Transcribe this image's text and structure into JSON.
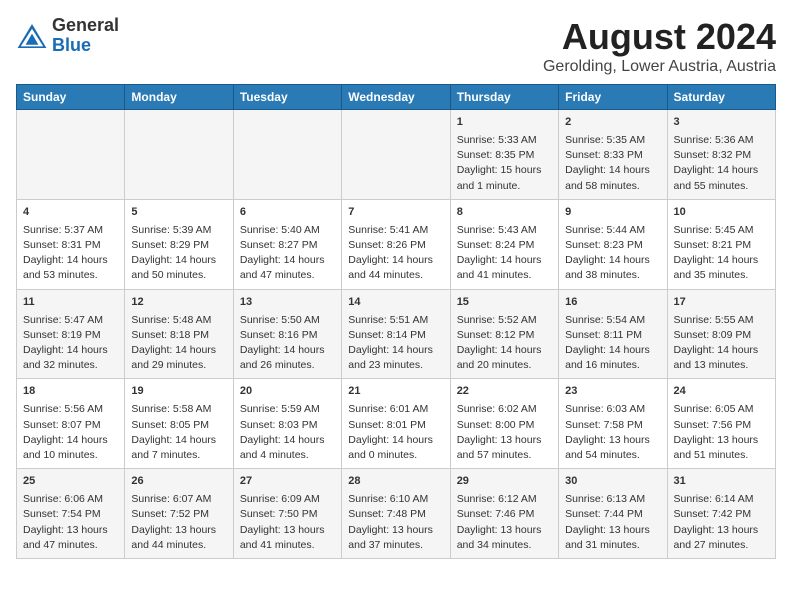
{
  "header": {
    "logo_general": "General",
    "logo_blue": "Blue",
    "main_title": "August 2024",
    "subtitle": "Gerolding, Lower Austria, Austria"
  },
  "columns": [
    "Sunday",
    "Monday",
    "Tuesday",
    "Wednesday",
    "Thursday",
    "Friday",
    "Saturday"
  ],
  "weeks": [
    {
      "days": [
        {
          "num": "",
          "content": ""
        },
        {
          "num": "",
          "content": ""
        },
        {
          "num": "",
          "content": ""
        },
        {
          "num": "",
          "content": ""
        },
        {
          "num": "1",
          "content": "Sunrise: 5:33 AM\nSunset: 8:35 PM\nDaylight: 15 hours\nand 1 minute."
        },
        {
          "num": "2",
          "content": "Sunrise: 5:35 AM\nSunset: 8:33 PM\nDaylight: 14 hours\nand 58 minutes."
        },
        {
          "num": "3",
          "content": "Sunrise: 5:36 AM\nSunset: 8:32 PM\nDaylight: 14 hours\nand 55 minutes."
        }
      ]
    },
    {
      "days": [
        {
          "num": "4",
          "content": "Sunrise: 5:37 AM\nSunset: 8:31 PM\nDaylight: 14 hours\nand 53 minutes."
        },
        {
          "num": "5",
          "content": "Sunrise: 5:39 AM\nSunset: 8:29 PM\nDaylight: 14 hours\nand 50 minutes."
        },
        {
          "num": "6",
          "content": "Sunrise: 5:40 AM\nSunset: 8:27 PM\nDaylight: 14 hours\nand 47 minutes."
        },
        {
          "num": "7",
          "content": "Sunrise: 5:41 AM\nSunset: 8:26 PM\nDaylight: 14 hours\nand 44 minutes."
        },
        {
          "num": "8",
          "content": "Sunrise: 5:43 AM\nSunset: 8:24 PM\nDaylight: 14 hours\nand 41 minutes."
        },
        {
          "num": "9",
          "content": "Sunrise: 5:44 AM\nSunset: 8:23 PM\nDaylight: 14 hours\nand 38 minutes."
        },
        {
          "num": "10",
          "content": "Sunrise: 5:45 AM\nSunset: 8:21 PM\nDaylight: 14 hours\nand 35 minutes."
        }
      ]
    },
    {
      "days": [
        {
          "num": "11",
          "content": "Sunrise: 5:47 AM\nSunset: 8:19 PM\nDaylight: 14 hours\nand 32 minutes."
        },
        {
          "num": "12",
          "content": "Sunrise: 5:48 AM\nSunset: 8:18 PM\nDaylight: 14 hours\nand 29 minutes."
        },
        {
          "num": "13",
          "content": "Sunrise: 5:50 AM\nSunset: 8:16 PM\nDaylight: 14 hours\nand 26 minutes."
        },
        {
          "num": "14",
          "content": "Sunrise: 5:51 AM\nSunset: 8:14 PM\nDaylight: 14 hours\nand 23 minutes."
        },
        {
          "num": "15",
          "content": "Sunrise: 5:52 AM\nSunset: 8:12 PM\nDaylight: 14 hours\nand 20 minutes."
        },
        {
          "num": "16",
          "content": "Sunrise: 5:54 AM\nSunset: 8:11 PM\nDaylight: 14 hours\nand 16 minutes."
        },
        {
          "num": "17",
          "content": "Sunrise: 5:55 AM\nSunset: 8:09 PM\nDaylight: 14 hours\nand 13 minutes."
        }
      ]
    },
    {
      "days": [
        {
          "num": "18",
          "content": "Sunrise: 5:56 AM\nSunset: 8:07 PM\nDaylight: 14 hours\nand 10 minutes."
        },
        {
          "num": "19",
          "content": "Sunrise: 5:58 AM\nSunset: 8:05 PM\nDaylight: 14 hours\nand 7 minutes."
        },
        {
          "num": "20",
          "content": "Sunrise: 5:59 AM\nSunset: 8:03 PM\nDaylight: 14 hours\nand 4 minutes."
        },
        {
          "num": "21",
          "content": "Sunrise: 6:01 AM\nSunset: 8:01 PM\nDaylight: 14 hours\nand 0 minutes."
        },
        {
          "num": "22",
          "content": "Sunrise: 6:02 AM\nSunset: 8:00 PM\nDaylight: 13 hours\nand 57 minutes."
        },
        {
          "num": "23",
          "content": "Sunrise: 6:03 AM\nSunset: 7:58 PM\nDaylight: 13 hours\nand 54 minutes."
        },
        {
          "num": "24",
          "content": "Sunrise: 6:05 AM\nSunset: 7:56 PM\nDaylight: 13 hours\nand 51 minutes."
        }
      ]
    },
    {
      "days": [
        {
          "num": "25",
          "content": "Sunrise: 6:06 AM\nSunset: 7:54 PM\nDaylight: 13 hours\nand 47 minutes."
        },
        {
          "num": "26",
          "content": "Sunrise: 6:07 AM\nSunset: 7:52 PM\nDaylight: 13 hours\nand 44 minutes."
        },
        {
          "num": "27",
          "content": "Sunrise: 6:09 AM\nSunset: 7:50 PM\nDaylight: 13 hours\nand 41 minutes."
        },
        {
          "num": "28",
          "content": "Sunrise: 6:10 AM\nSunset: 7:48 PM\nDaylight: 13 hours\nand 37 minutes."
        },
        {
          "num": "29",
          "content": "Sunrise: 6:12 AM\nSunset: 7:46 PM\nDaylight: 13 hours\nand 34 minutes."
        },
        {
          "num": "30",
          "content": "Sunrise: 6:13 AM\nSunset: 7:44 PM\nDaylight: 13 hours\nand 31 minutes."
        },
        {
          "num": "31",
          "content": "Sunrise: 6:14 AM\nSunset: 7:42 PM\nDaylight: 13 hours\nand 27 minutes."
        }
      ]
    }
  ]
}
